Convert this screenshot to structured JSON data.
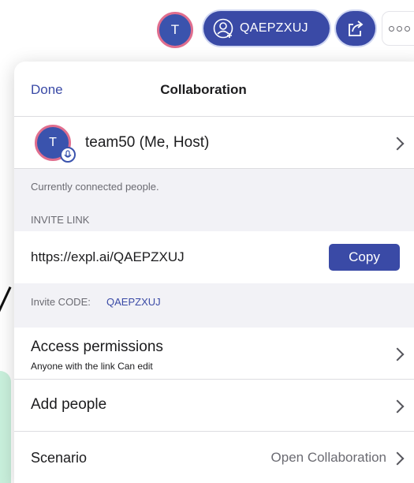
{
  "toolbar": {
    "avatar_initial": "T",
    "session_code": "QAEPZXUJ",
    "person_icon": "person-add-icon",
    "share_icon": "share-icon",
    "more_icon": "more-icon"
  },
  "popover": {
    "done_label": "Done",
    "title": "Collaboration",
    "host": {
      "initial": "T",
      "name": "team50 (Me, Host)",
      "badge_icon": "microphone-icon"
    },
    "connected_caption": "Currently connected people.",
    "invite_link_header": "INVITE LINK",
    "invite_link": "https://expl.ai/QAEPZXUJ",
    "copy_label": "Copy",
    "invite_code_label": "Invite CODE:",
    "invite_code": "QAEPZXUJ",
    "access": {
      "title": "Access permissions",
      "subtitle": "Anyone with the link Can edit"
    },
    "add_people_label": "Add people",
    "scenario": {
      "label": "Scenario",
      "value": "Open Collaboration"
    }
  },
  "colors": {
    "accent": "#3a4aa6",
    "avatar_ring": "#e06e8e",
    "group_background": "#f2f2f6",
    "canvas_mint": "#c9f0dc"
  }
}
